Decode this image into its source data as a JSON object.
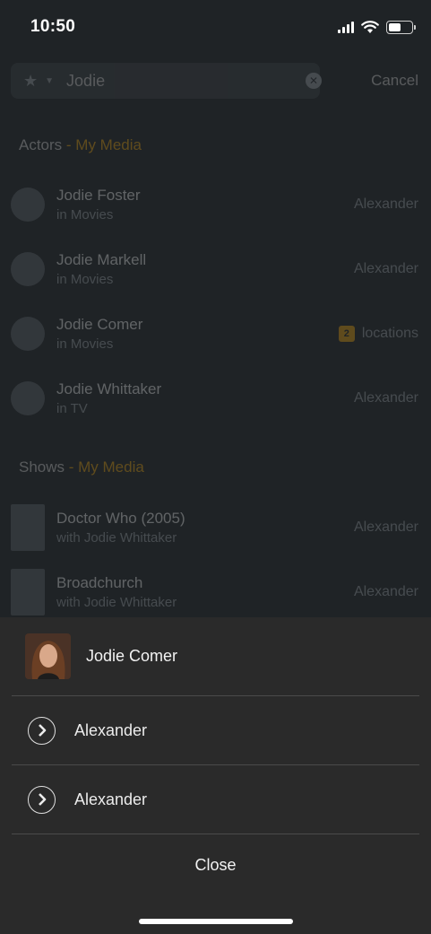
{
  "status_bar": {
    "time": "10:50"
  },
  "search": {
    "query": "Jodie",
    "cancel_label": "Cancel"
  },
  "sections": {
    "actors": {
      "title": "Actors",
      "separator": " - ",
      "subtitle": "My Media"
    },
    "shows": {
      "title": "Shows",
      "separator": " - ",
      "subtitle": "My Media"
    }
  },
  "actor_results": [
    {
      "name": "Jodie Foster",
      "context": "in Movies",
      "server": "Alexander"
    },
    {
      "name": "Jodie Markell",
      "context": "in Movies",
      "server": "Alexander"
    },
    {
      "name": "Jodie Comer",
      "context": "in Movies",
      "server": "locations",
      "badge": "2"
    },
    {
      "name": "Jodie Whittaker",
      "context": "in TV",
      "server": "Alexander"
    }
  ],
  "show_results": [
    {
      "name": "Doctor Who (2005)",
      "context": "with Jodie Whittaker",
      "server": "Alexander"
    },
    {
      "name": "Broadchurch",
      "context": "with Jodie Whittaker",
      "server": "Alexander"
    }
  ],
  "sheet": {
    "title": "Jodie Comer",
    "options": [
      {
        "label": "Alexander",
        "icon": "chevron-right-circle-icon"
      },
      {
        "label": "Alexander",
        "icon": "chevron-right-circle-icon"
      }
    ],
    "close_label": "Close"
  },
  "colors": {
    "accent": "#e5a00d",
    "sheet_background": "#2a2a2a",
    "page_background": "#1f2326"
  }
}
